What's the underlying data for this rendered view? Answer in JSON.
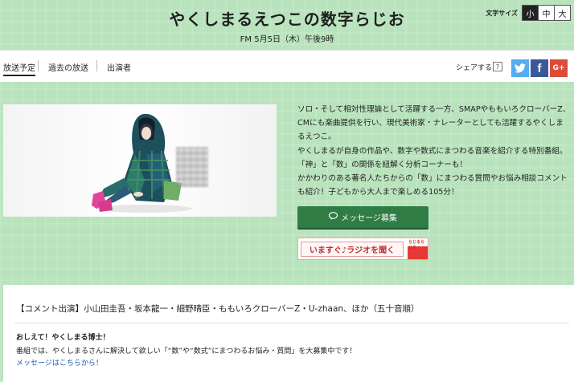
{
  "header": {
    "title": "やくしまるえつこの数字らじお",
    "subtitle": "FM 5月5日（木）午後9時",
    "font_size_label": "文字サイズ",
    "font_sizes": [
      "小",
      "中",
      "大"
    ],
    "font_size_selected": "小"
  },
  "nav": {
    "items": [
      "放送予定",
      "過去の放送",
      "出演者"
    ],
    "active": "放送予定",
    "share_label": "シェアする",
    "help": "?",
    "social": {
      "twitter_icon": "twitter-icon",
      "facebook_icon": "facebook-icon",
      "facebook_glyph": "f",
      "googleplus_icon": "google-plus-icon",
      "googleplus_glyph": "G+"
    }
  },
  "main": {
    "description": [
      "ソロ・そして相対性理論として活躍する一方、SMAPやももいろクローバーZ、CMにも楽曲提供を行い、現代美術家・ナレーターとしても活躍するやくしまるえつこ。",
      "やくしまるが自身の作品や、数字や数式にまつわる音楽を紹介する特別番組。",
      "「神」と「数」の関係を紐解く分析コーナーも！",
      "かかわりのある著名人たちからの「数」にまつわる質問やお悩み相談コメントも紹介！子どもから大人まで楽しめる105分！"
    ],
    "message_button": "メッセージ募集",
    "radio_button": "いますぐ♪ラジオを聞く",
    "radiko_text": "らじるらじる"
  },
  "info": {
    "comment": "【コメント出演】小山田圭吾・坂本龍一・細野晴臣・ももいろクローバーZ・U-zhaan、ほか（五十音順）",
    "ask_title": "おしえて！やくしまる博士！",
    "ask_body": "番組では、やくしまるさんに解決して欲しい「“数”や“数式”にまつわるお悩み・質問」を大募集中です！",
    "ask_link": "メッセージはこちらから！"
  },
  "colors": {
    "background": "#b9e3bd",
    "message_button": "#2f7d45",
    "twitter": "#55acee",
    "facebook": "#3b5998",
    "googleplus": "#dd4b39",
    "link": "#1a5fb4"
  }
}
